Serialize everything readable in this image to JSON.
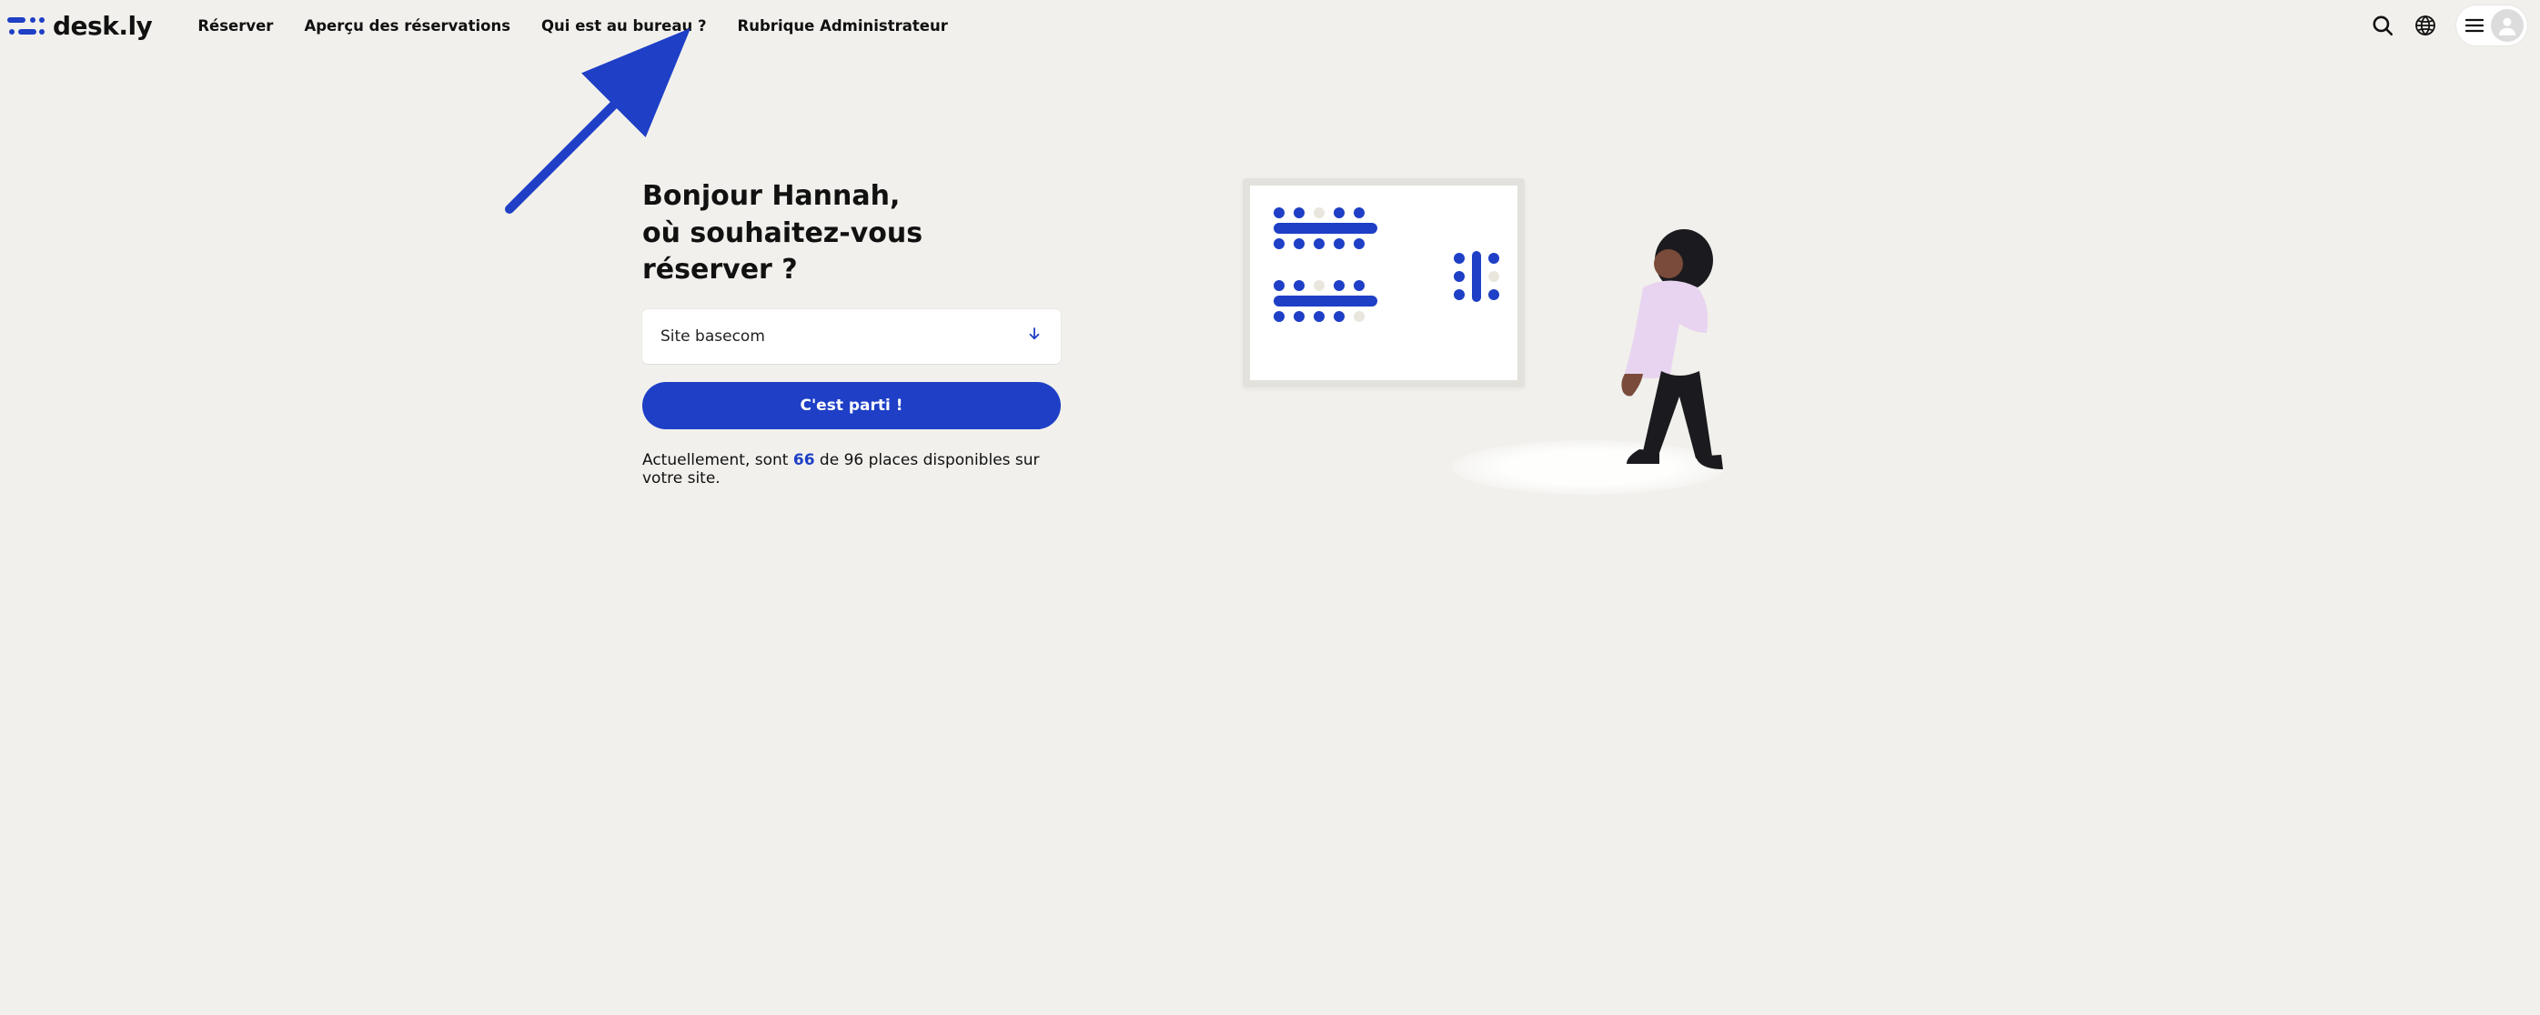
{
  "brand": {
    "name": "desk.ly"
  },
  "nav": {
    "items": [
      {
        "label": "Réserver"
      },
      {
        "label": "Aperçu des réservations"
      },
      {
        "label": "Qui est au bureau ?"
      },
      {
        "label": "Rubrique Administrateur"
      }
    ]
  },
  "hero": {
    "line1": "Bonjour Hannah,",
    "line2": "où souhaitez-vous réserver ?"
  },
  "site_select": {
    "selected": "Site basecom"
  },
  "cta": {
    "label": "C'est parti !"
  },
  "status": {
    "prefix": "Actuellement, sont ",
    "count": "66",
    "middle": " de 96 places disponibles sur votre site."
  },
  "colors": {
    "blue": "#1e3fc6",
    "beige": "#e9e6dd",
    "bg": "#F1F0EC"
  }
}
